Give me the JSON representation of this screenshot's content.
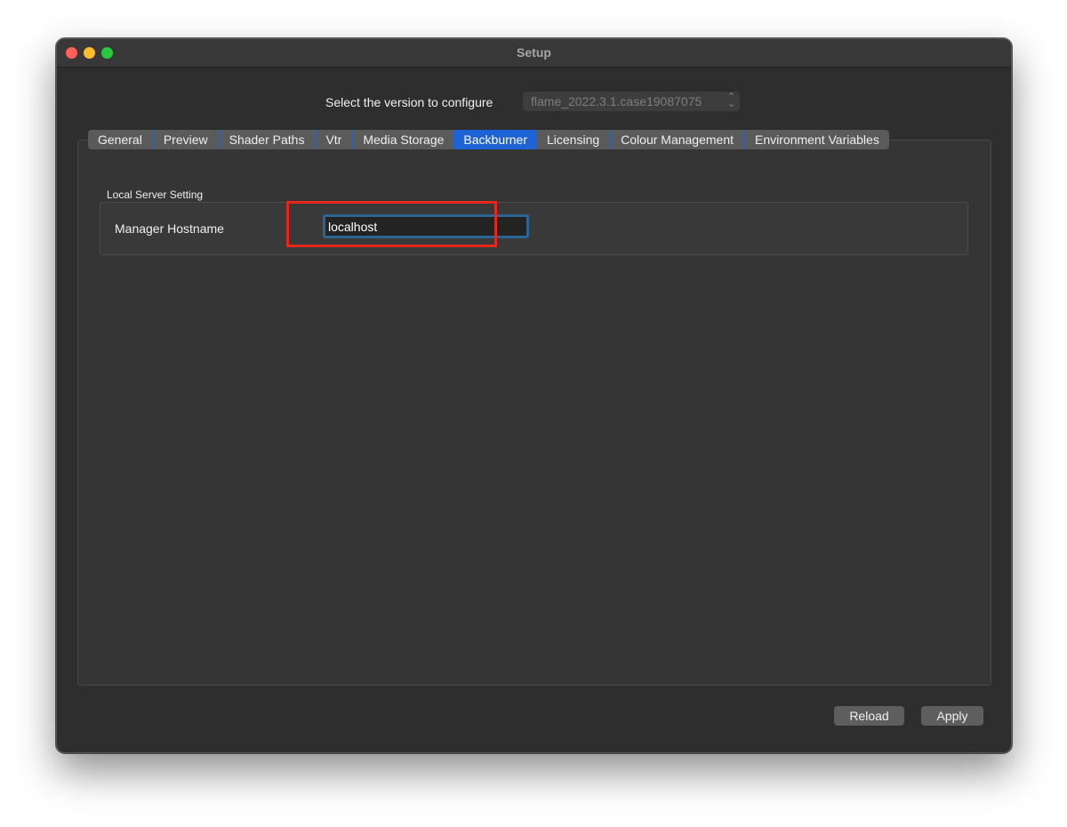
{
  "window": {
    "title": "Setup"
  },
  "version": {
    "label": "Select the version to configure",
    "selected": "flame_2022.3.1.case19087075"
  },
  "tabs": [
    {
      "label": "General",
      "active": false
    },
    {
      "label": "Preview",
      "active": false
    },
    {
      "label": "Shader Paths",
      "active": false
    },
    {
      "label": "Vtr",
      "active": false
    },
    {
      "label": "Media Storage",
      "active": false
    },
    {
      "label": "Backburner",
      "active": true
    },
    {
      "label": "Licensing",
      "active": false
    },
    {
      "label": "Colour Management",
      "active": false
    },
    {
      "label": "Environment Variables",
      "active": false
    }
  ],
  "local_server": {
    "group_title": "Local Server Setting",
    "manager_hostname_label": "Manager Hostname",
    "manager_hostname_value": "localhost"
  },
  "buttons": {
    "reload": "Reload",
    "apply": "Apply"
  },
  "colors": {
    "active_tab": "#1e63d6",
    "highlight": "#e5261c",
    "focus_ring": "#2b6594"
  }
}
